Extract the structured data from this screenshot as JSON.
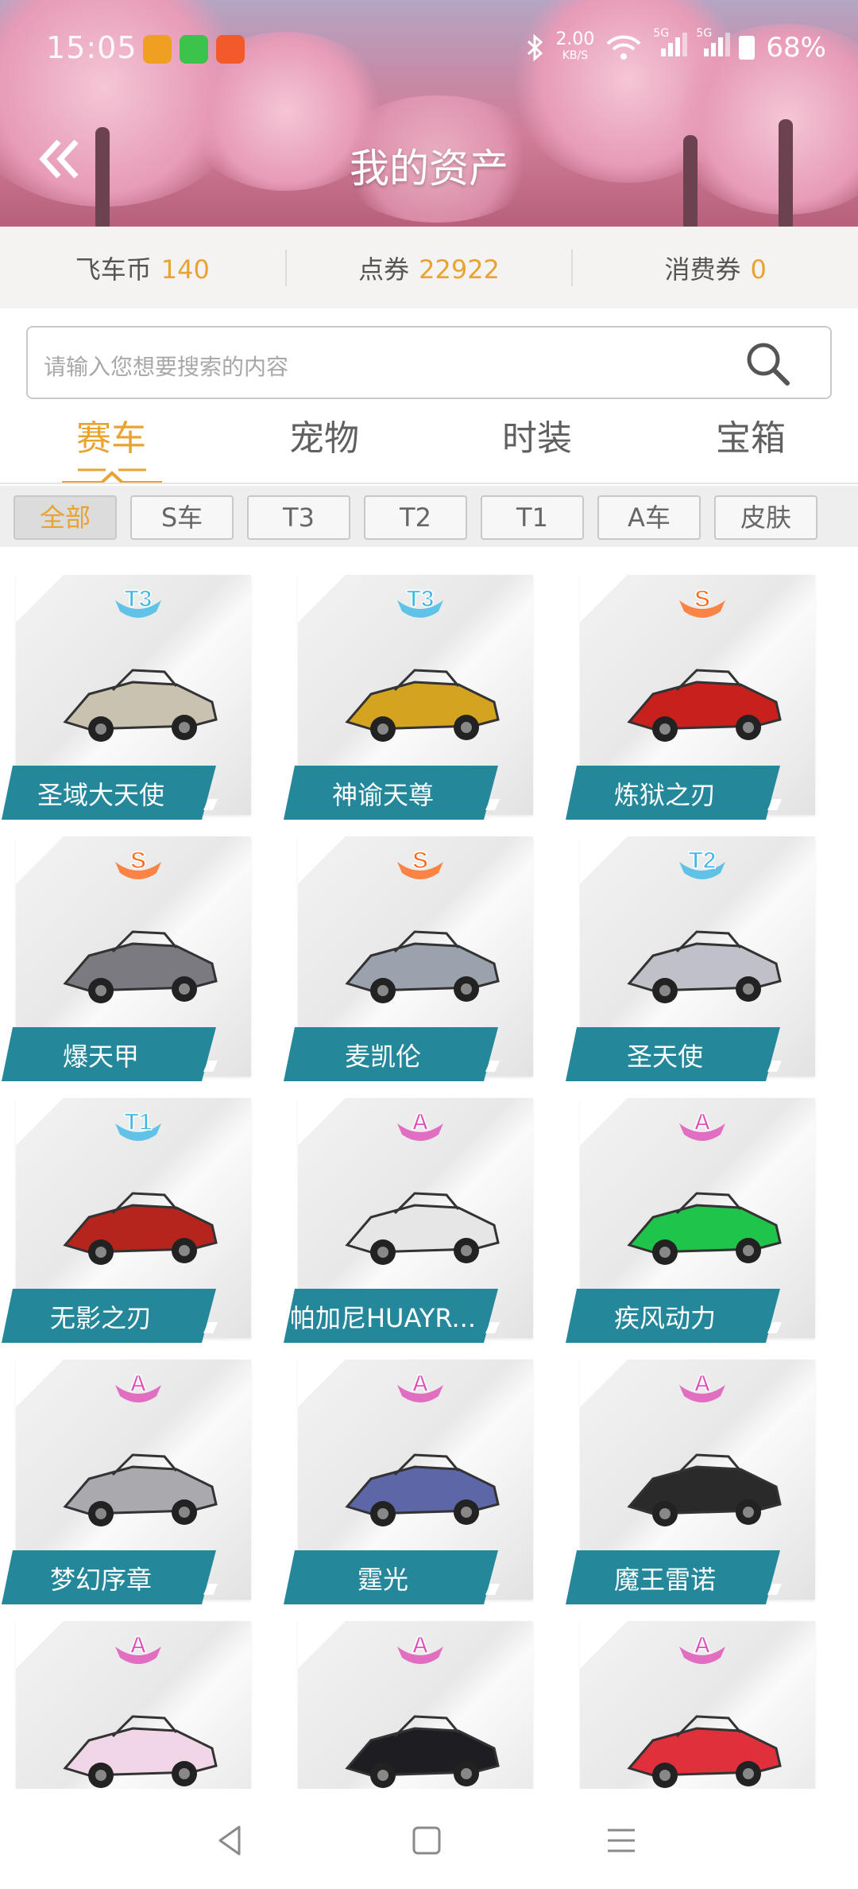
{
  "status_bar": {
    "time": "15:05",
    "net_speed_value": "2.00",
    "net_speed_unit": "KB/S",
    "signal_1": "5G",
    "signal_2": "5G",
    "battery": "68%"
  },
  "header": {
    "title": "我的资产"
  },
  "currency": [
    {
      "label": "飞车币",
      "value": "140"
    },
    {
      "label": "点券",
      "value": "22922"
    },
    {
      "label": "消费券",
      "value": "0"
    }
  ],
  "search": {
    "placeholder": "请输入您想要搜索的内容"
  },
  "tabs": [
    "赛车",
    "宠物",
    "时装",
    "宝箱"
  ],
  "active_tab": "赛车",
  "filters": [
    "全部",
    "S车",
    "T3",
    "T2",
    "T1",
    "A车",
    "皮肤"
  ],
  "active_filter": "全部",
  "items": [
    {
      "name": "圣域大天使",
      "grade": "T3",
      "icon": "mech-robot"
    },
    {
      "name": "神谕天尊",
      "grade": "T3",
      "icon": "gold-mech"
    },
    {
      "name": "炼狱之刃",
      "grade": "S",
      "icon": "red-racer"
    },
    {
      "name": "爆天甲",
      "grade": "S",
      "icon": "armored-car"
    },
    {
      "name": "麦凯伦",
      "grade": "S",
      "icon": "silver-racer"
    },
    {
      "name": "圣天使",
      "grade": "T2",
      "icon": "winged-mech"
    },
    {
      "name": "无影之刃",
      "grade": "T1",
      "icon": "red-mech"
    },
    {
      "name": "帕加尼HUAYR...",
      "grade": "A",
      "icon": "white-supercar"
    },
    {
      "name": "疾风动力",
      "grade": "A",
      "icon": "green-supercar"
    },
    {
      "name": "梦幻序章",
      "grade": "A",
      "icon": "classic-silver-car"
    },
    {
      "name": "霆光",
      "grade": "A",
      "icon": "blue-racer"
    },
    {
      "name": "魔王雷诺",
      "grade": "A",
      "icon": "monster-truck"
    },
    {
      "name": "",
      "grade": "A",
      "icon": "pink-racer"
    },
    {
      "name": "",
      "grade": "A",
      "icon": "black-racer"
    },
    {
      "name": "",
      "grade": "A",
      "icon": "red-sportscar"
    }
  ],
  "colors": {
    "accent": "#e8a331",
    "ribbon": "#24879a",
    "grade_T": "#3fb8e6",
    "grade_S": "#ff6a1a",
    "grade_A": "#e04fb8"
  }
}
